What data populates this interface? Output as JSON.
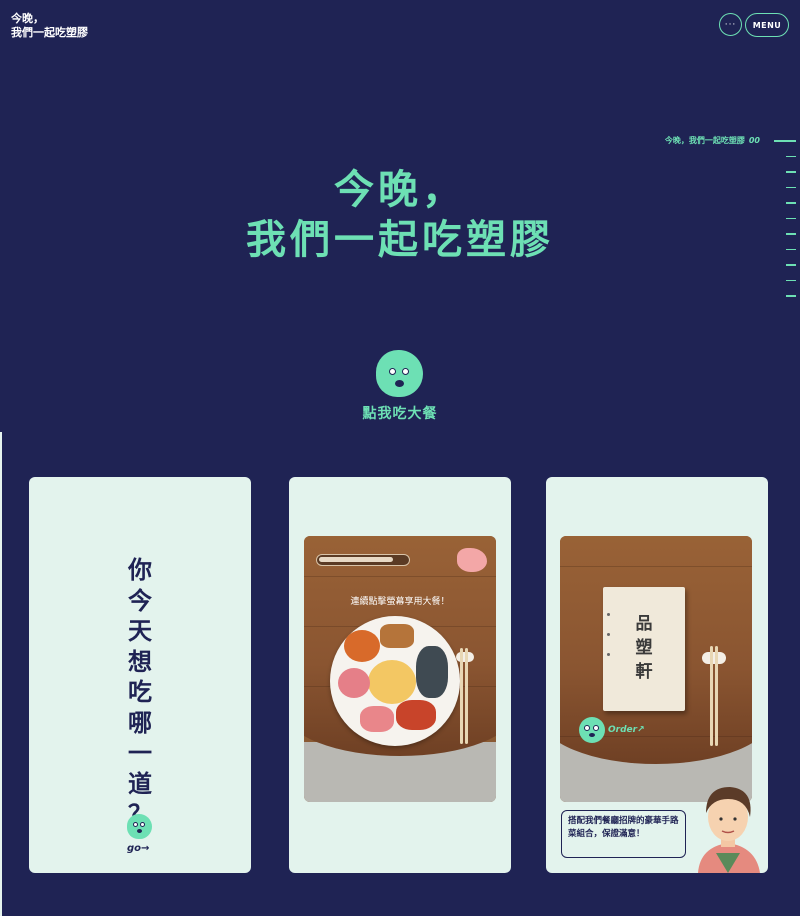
{
  "header": {
    "logo_line1": "今晚，",
    "logo_line2": "我們一起吃塑膠",
    "dots_label": "···",
    "menu_label": "MENU"
  },
  "scroll_indicator": {
    "label": "今晚，我們一起吃塑膠",
    "number": "00"
  },
  "hero": {
    "line1": "今晚，",
    "line2": "我們一起吃塑膠"
  },
  "cta": {
    "label": "點我吃大餐"
  },
  "cards": {
    "question": {
      "chars": [
        "你",
        "今",
        "天",
        "想",
        "吃",
        "哪",
        "一",
        "道",
        "？"
      ],
      "go_label": "go→"
    },
    "meal": {
      "tap_instruction": "連續點擊螢幕享用大餐！",
      "progress": 0.85
    },
    "order": {
      "menu_title_chars": [
        "品",
        "塑",
        "軒"
      ],
      "order_label": "Order↗",
      "bubble_text": "搭配我們餐廳招牌的豪華手路菜組合，保證滿意！"
    }
  },
  "colors": {
    "background": "#1f2354",
    "accent": "#6de0b4",
    "card": "#e3f3ed"
  }
}
